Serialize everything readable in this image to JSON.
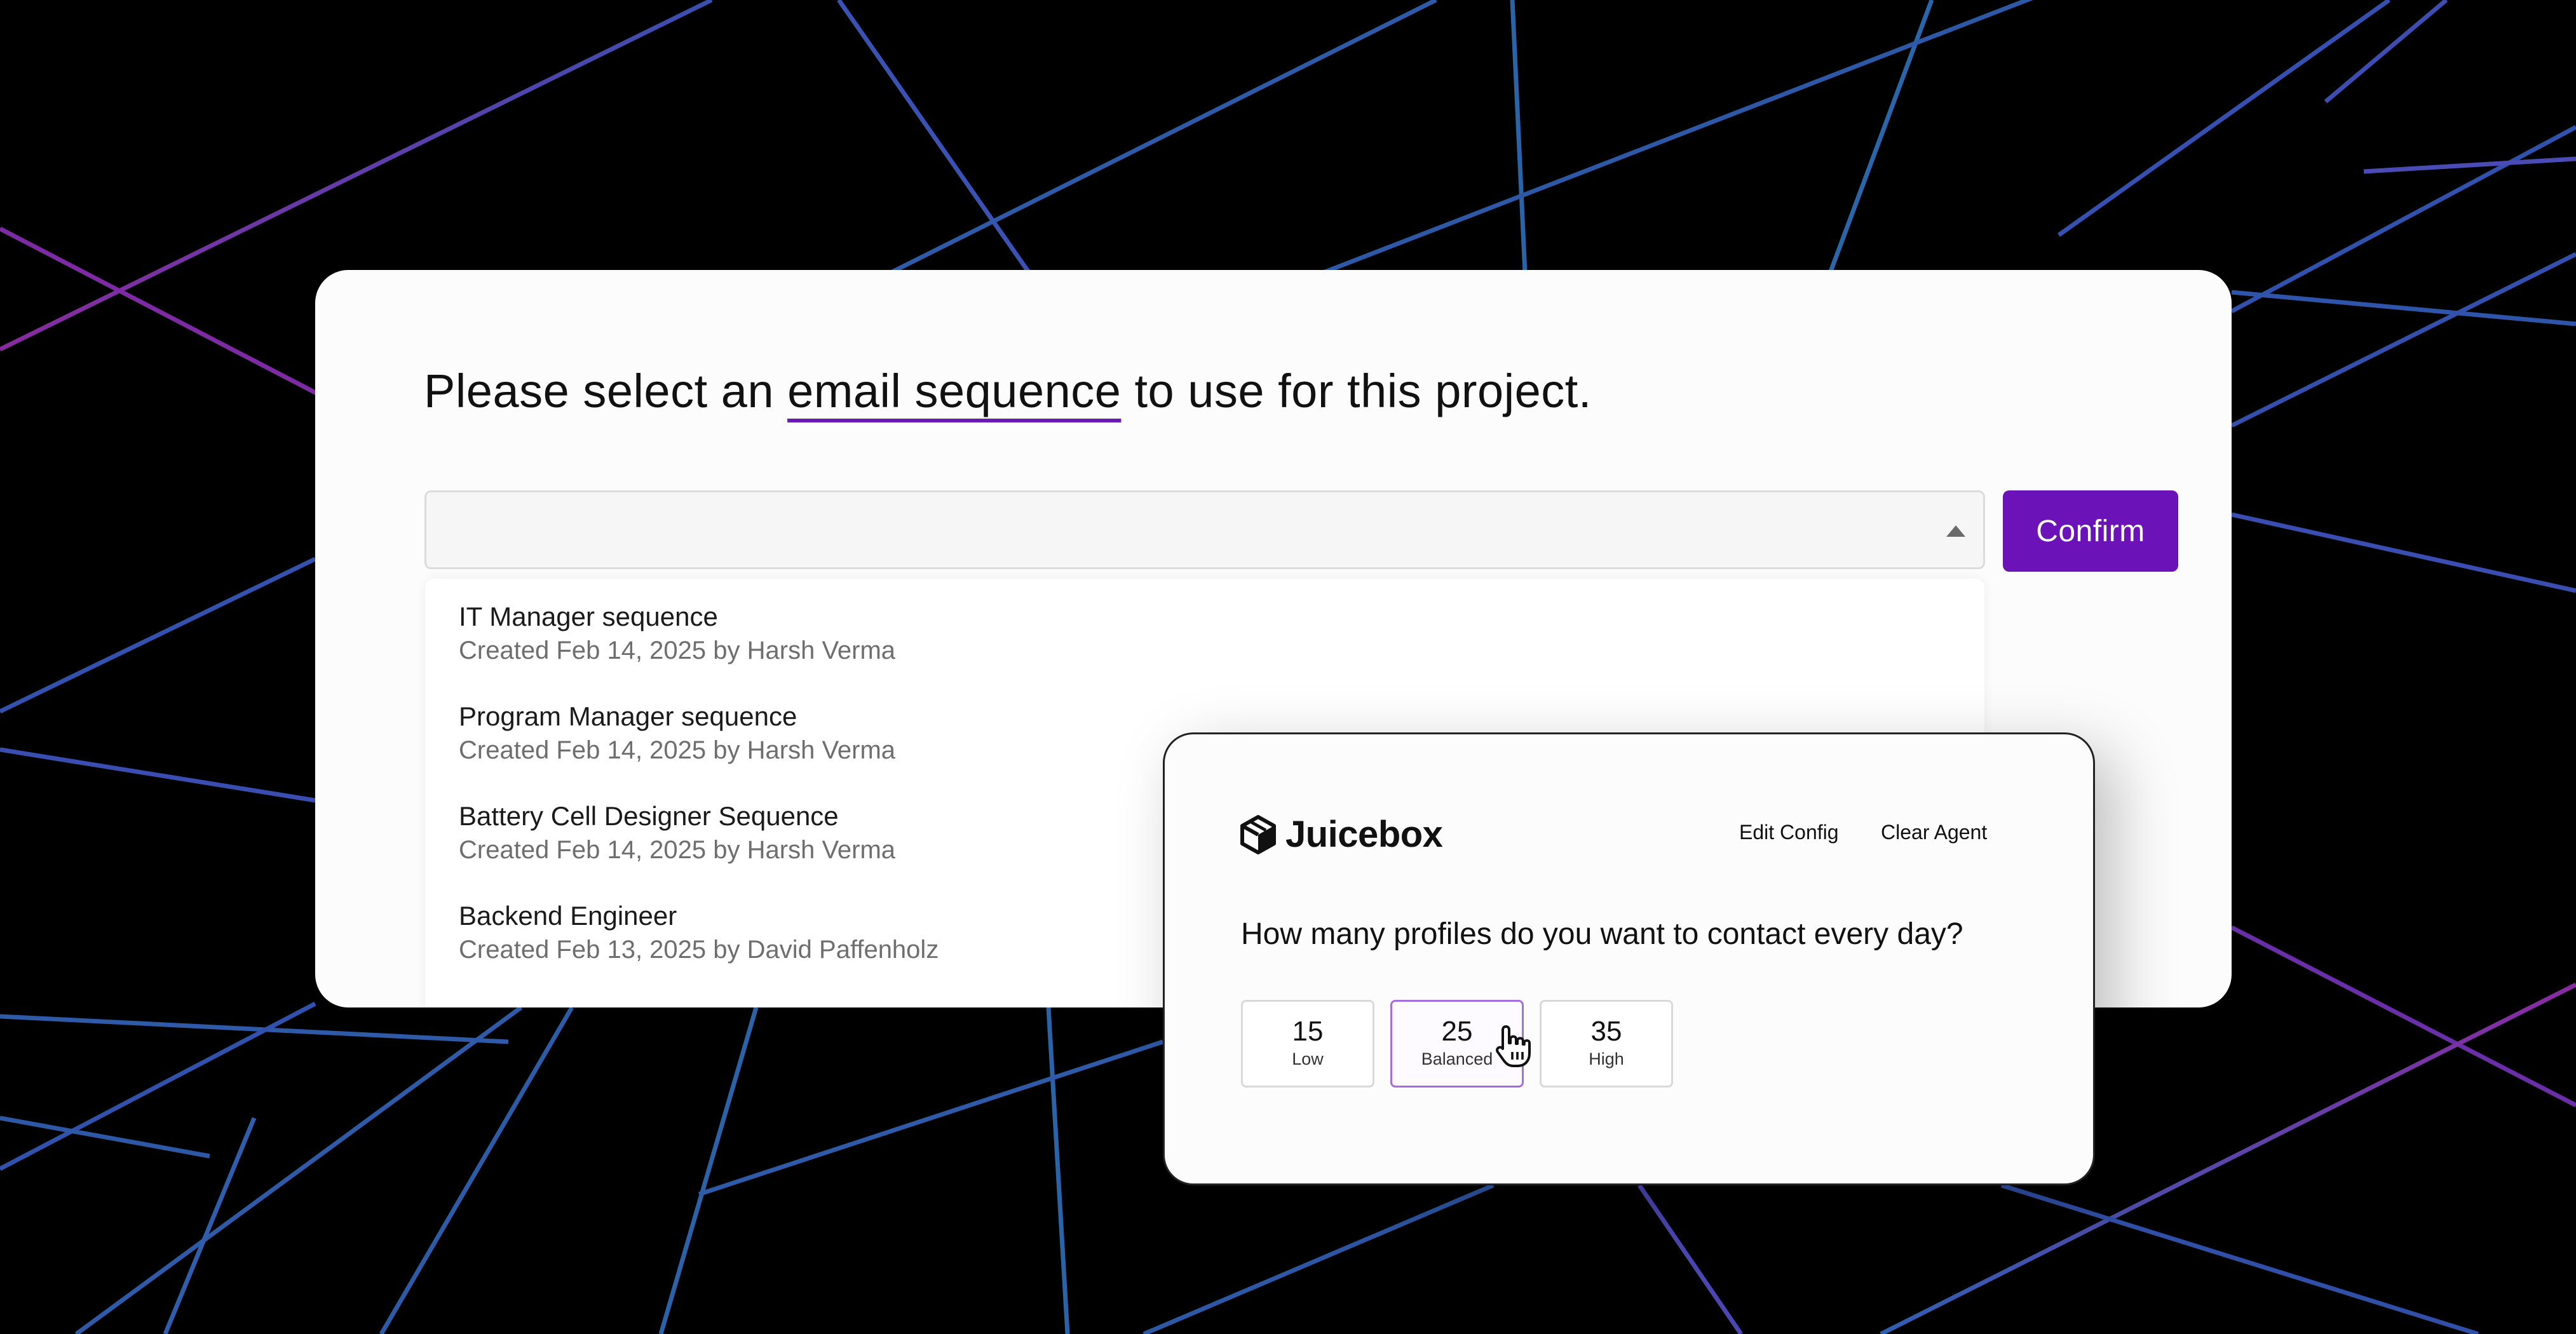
{
  "prompt": {
    "before": "Please select an",
    "highlight": "email sequence",
    "after": "to use for this project."
  },
  "select": {
    "value": ""
  },
  "confirm_label": "Confirm",
  "options": [
    {
      "title": "IT Manager sequence",
      "subtitle": "Created Feb 14, 2025 by Harsh Verma"
    },
    {
      "title": "Program Manager sequence",
      "subtitle": "Created Feb 14, 2025 by Harsh Verma"
    },
    {
      "title": "Battery Cell Designer Sequence",
      "subtitle": "Created Feb 14, 2025 by Harsh Verma"
    },
    {
      "title": "Backend Engineer",
      "subtitle": "Created Feb 13, 2025 by David Paffenholz"
    }
  ],
  "agent": {
    "brand": "Juicebox",
    "edit_config": "Edit Config",
    "clear_agent": "Clear Agent",
    "question": "How many profiles do you want to contact every day?",
    "choices": [
      {
        "value": "15",
        "label": "Low"
      },
      {
        "value": "25",
        "label": "Balanced",
        "selected": true
      },
      {
        "value": "35",
        "label": "High"
      }
    ]
  },
  "icons": {
    "select": "caret-up-icon",
    "logo": "juicebox-logo-icon",
    "pointer": "hand-pointer-icon"
  },
  "colors": {
    "accent": "#6b13b8",
    "underline": "#6a1bb4",
    "selected_border": "#a56de0",
    "background": "#000000",
    "line_purple": "#7a2fa8",
    "line_blue": "#2c5aa0"
  }
}
